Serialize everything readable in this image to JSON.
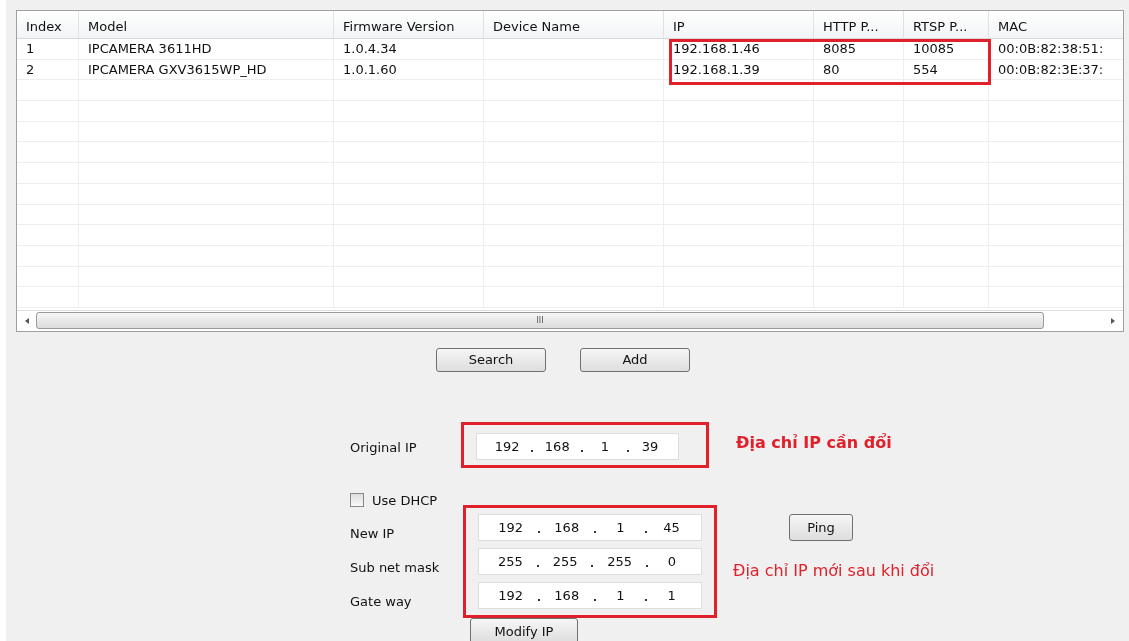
{
  "table": {
    "columns": [
      "Index",
      "Model",
      "Firmware Version",
      "Device Name",
      "IP",
      "HTTP P...",
      "RTSP P...",
      "MAC"
    ],
    "rows": [
      [
        "1",
        "IPCAMERA 3611HD",
        "1.0.4.34",
        "",
        "192.168.1.46",
        "8085",
        "10085",
        "00:0B:82:38:51:"
      ],
      [
        "2",
        "IPCAMERA GXV3615WP_HD",
        "1.0.1.60",
        "",
        "192.168.1.39",
        "80",
        "554",
        "00:0B:82:3E:37:"
      ]
    ],
    "scrollbar_grip": "III"
  },
  "buttons": [
    "Search",
    "Add"
  ],
  "original_ip": {
    "label": "Original IP",
    "octets": [
      "192",
      "168",
      "1",
      "39"
    ],
    "note": "Địa chỉ IP cần đổi"
  },
  "use_dhcp": {
    "label": "Use DHCP",
    "checked": false
  },
  "new_settings": [
    {
      "label": "New IP",
      "octets": [
        "192",
        "168",
        "1",
        "45"
      ]
    },
    {
      "label": "Sub net mask",
      "octets": [
        "255",
        "255",
        "255",
        "0"
      ]
    },
    {
      "label": "Gate way",
      "octets": [
        "192",
        "168",
        "1",
        "1"
      ]
    }
  ],
  "ping_button": "Ping",
  "new_note": "Địa chỉ IP mới sau khi đổi",
  "modify_button": "Modify IP"
}
